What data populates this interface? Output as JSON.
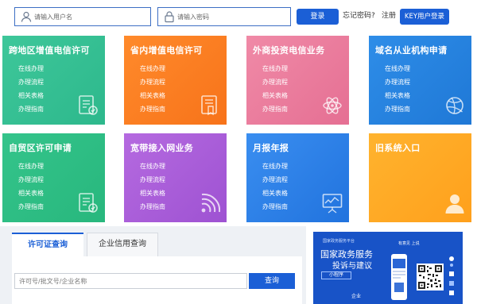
{
  "login": {
    "username_placeholder": "请输入用户名",
    "password_placeholder": "请输入密码",
    "login_button": "登录",
    "forgot_password": "忘记密码?",
    "register": "注册",
    "key_login": "KEY用户登录"
  },
  "tiles": [
    {
      "title": "跨地区增值电信许可",
      "links": [
        "在线办理",
        "办理流程",
        "相关表格",
        "办理指南"
      ],
      "icon": "document-check-icon",
      "color": "#2db88c"
    },
    {
      "title": "省内增值电信许可",
      "links": [
        "在线办理",
        "办理流程",
        "相关表格",
        "办理指南"
      ],
      "icon": "certificate-icon",
      "color": "#f7731a"
    },
    {
      "title": "外商投资电信业务",
      "links": [
        "在线办理",
        "办理流程",
        "相关表格",
        "办理指南"
      ],
      "icon": "atom-icon",
      "color": "#e56f93"
    },
    {
      "title": "域名从业机构申请",
      "links": [
        "在线办理",
        "办理流程",
        "相关表格",
        "办理指南"
      ],
      "icon": "globe-icon",
      "color": "#1f78d6"
    },
    {
      "title": "自贸区许可申请",
      "links": [
        "在线办理",
        "办理流程",
        "相关表格",
        "办理指南"
      ],
      "icon": "document-check-icon",
      "color": "#28b77d"
    },
    {
      "title": "宽带接入网业务",
      "links": [
        "在线办理",
        "办理流程",
        "相关表格",
        "办理指南"
      ],
      "icon": "wifi-signal-icon",
      "color": "#9e52d2"
    },
    {
      "title": "月报年报",
      "links": [
        "在线办理",
        "办理流程",
        "相关表格",
        "办理指南"
      ],
      "icon": "chart-board-icon",
      "color": "#2173de"
    },
    {
      "title": "旧系统入口",
      "links": [],
      "icon": "user-icon",
      "color": "#ffa01c"
    }
  ],
  "query": {
    "tab_license": "许可证查询",
    "tab_credit": "企业信用查询",
    "input_placeholder": "许可号/批文号/企业名称",
    "search_button": "查询"
  },
  "promo": {
    "top_small": "国家政务服务平台",
    "line1": "国家政务服务",
    "line2": "投诉与建议",
    "mini": "小程序",
    "right_small": "有意见 上说",
    "phone_label": "企业"
  }
}
